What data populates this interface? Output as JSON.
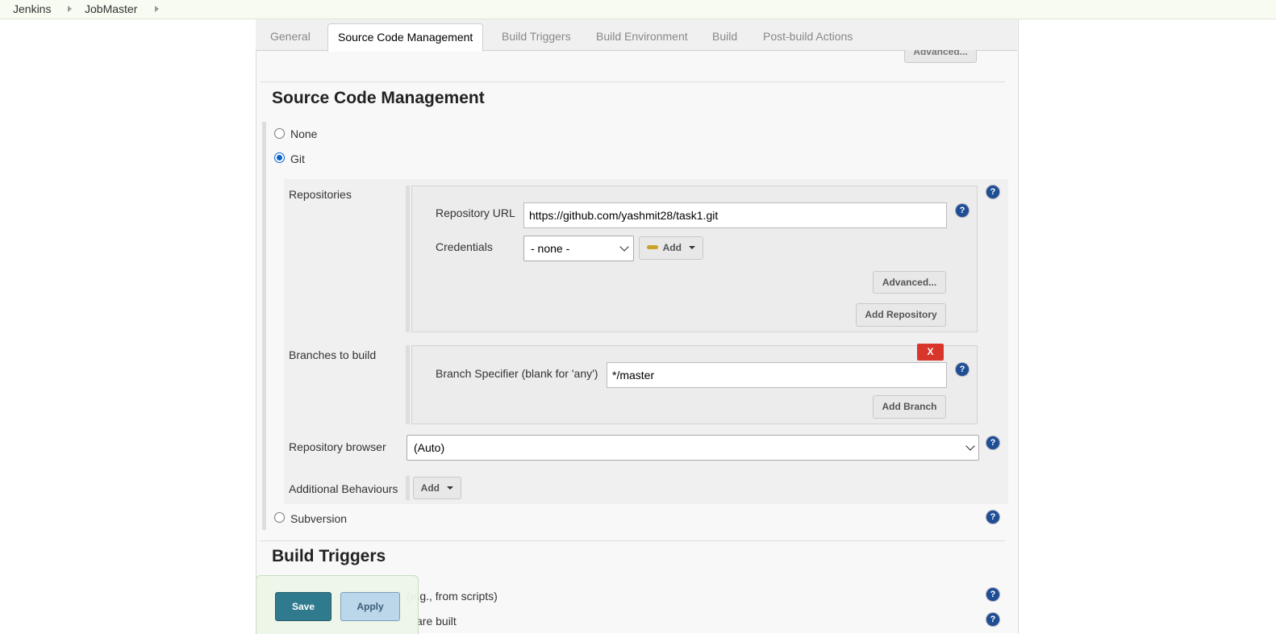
{
  "breadcrumb": {
    "items": [
      "Jenkins",
      "JobMaster"
    ]
  },
  "tabs": [
    {
      "label": "General",
      "active": false
    },
    {
      "label": "Source Code Management",
      "active": true
    },
    {
      "label": "Build Triggers",
      "active": false
    },
    {
      "label": "Build Environment",
      "active": false
    },
    {
      "label": "Build",
      "active": false
    },
    {
      "label": "Post-build Actions",
      "active": false
    }
  ],
  "top_advanced_label": "Advanced...",
  "scm": {
    "title": "Source Code Management",
    "options": {
      "none": "None",
      "git": "Git",
      "subversion": "Subversion"
    },
    "selected": "Git",
    "repositories_label": "Repositories",
    "repo_url_label": "Repository URL",
    "repo_url_value": "https://github.com/yashmit28/task1.git",
    "credentials_label": "Credentials",
    "credentials_value": "- none -",
    "add_label": "Add",
    "advanced_label": "Advanced...",
    "add_repository_label": "Add Repository",
    "branches_label": "Branches to build",
    "delete_label": "X",
    "branch_specifier_label": "Branch Specifier (blank for 'any')",
    "branch_specifier_value": "*/master",
    "add_branch_label": "Add Branch",
    "repo_browser_label": "Repository browser",
    "repo_browser_value": "(Auto)",
    "additional_behaviours_label": "Additional Behaviours",
    "additional_add_label": "Add"
  },
  "build_triggers": {
    "title": "Build Triggers",
    "option1_visible": "(e.g., from scripts)",
    "option2_visible": "are built"
  },
  "help_glyph": "?",
  "footer": {
    "save_label": "Save",
    "apply_label": "Apply"
  },
  "colors": {
    "save_bg": "#2f7a8c",
    "apply_bg": "#bcd6ea",
    "delete_bg": "#d9362b",
    "help_bg": "#1f4e94"
  }
}
